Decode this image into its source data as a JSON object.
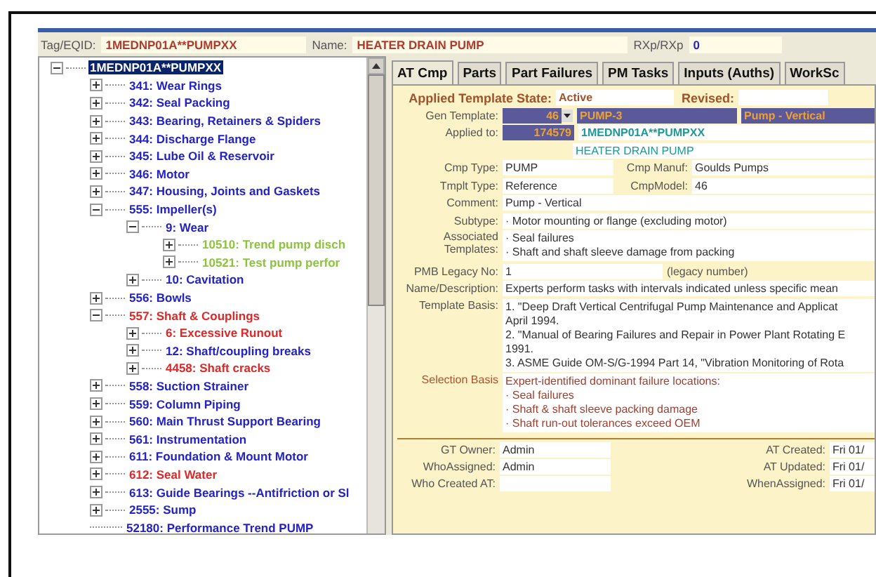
{
  "header": {
    "tag_label": "Tag/EQID:",
    "tag_value": "1MEDNP01A**PUMPXX",
    "name_label": "Name:",
    "name_value": "HEATER DRAIN PUMP",
    "rxp_label": "RXp/RXp",
    "rxp_value": "0"
  },
  "tree": {
    "root": {
      "label": "1MEDNP01A**PUMPXX",
      "selected": true,
      "expanded": true,
      "children": [
        {
          "label": "341: Wear Rings",
          "color": "#2323c8",
          "kind": "folder",
          "expanded": false
        },
        {
          "label": "342: Seal Packing",
          "color": "#2323c8",
          "kind": "folder",
          "expanded": false
        },
        {
          "label": "343: Bearing, Retainers & Spiders",
          "color": "#2323c8",
          "kind": "folder",
          "expanded": false
        },
        {
          "label": "344: Discharge Flange",
          "color": "#2323c8",
          "kind": "folder",
          "expanded": false
        },
        {
          "label": "345: Lube Oil & Reservoir",
          "color": "#2323c8",
          "kind": "folder",
          "expanded": false
        },
        {
          "label": "346: Motor",
          "color": "#2323c8",
          "kind": "folder",
          "expanded": false
        },
        {
          "label": "347: Housing, Joints and Gaskets",
          "color": "#2323c8",
          "kind": "folder",
          "expanded": false
        },
        {
          "label": "555: Impeller(s)",
          "color": "#2323c8",
          "kind": "folder",
          "expanded": true,
          "children": [
            {
              "label": "9: Wear",
              "color": "#2323c8",
              "kind": "folder",
              "expanded": true,
              "children": [
                {
                  "label": "10510: Trend pump disch",
                  "color": "#8cc43c",
                  "kind": "folder",
                  "expanded": false
                },
                {
                  "label": "10521: Test pump perfor",
                  "color": "#8cc43c",
                  "kind": "folder",
                  "expanded": false
                }
              ]
            },
            {
              "label": "10: Cavitation",
              "color": "#2323c8",
              "kind": "folder",
              "expanded": false
            }
          ]
        },
        {
          "label": "556: Bowls",
          "color": "#2323c8",
          "kind": "folder",
          "expanded": false
        },
        {
          "label": "557: Shaft & Couplings",
          "color": "#e02828",
          "kind": "folder",
          "expanded": true,
          "children": [
            {
              "label": "6: Excessive Runout",
              "color": "#e02828",
              "kind": "folder",
              "expanded": false
            },
            {
              "label": "12: Shaft/coupling breaks",
              "color": "#2323c8",
              "kind": "folder",
              "expanded": false
            },
            {
              "label": "4458: Shaft cracks",
              "color": "#e02828",
              "kind": "folder",
              "expanded": false
            }
          ]
        },
        {
          "label": "558: Suction Strainer",
          "color": "#2323c8",
          "kind": "folder",
          "expanded": false
        },
        {
          "label": "559: Column Piping",
          "color": "#2323c8",
          "kind": "folder",
          "expanded": false
        },
        {
          "label": "560: Main Thrust Support Bearing",
          "color": "#2323c8",
          "kind": "folder",
          "expanded": false
        },
        {
          "label": "561: Instrumentation",
          "color": "#2323c8",
          "kind": "folder",
          "expanded": false
        },
        {
          "label": "611: Foundation & Mount Motor",
          "color": "#2323c8",
          "kind": "folder",
          "expanded": false
        },
        {
          "label": "612: Seal Water",
          "color": "#e02828",
          "kind": "folder",
          "expanded": false
        },
        {
          "label": "613: Guide Bearings --Antifriction or Sl",
          "color": "#2323c8",
          "kind": "folder",
          "expanded": false
        },
        {
          "label": "2555: Sump",
          "color": "#2323c8",
          "kind": "folder",
          "expanded": false
        },
        {
          "label": "52180: Performance Trend PUMP",
          "color": "#2323c8",
          "kind": "leaf"
        }
      ]
    }
  },
  "tabs": [
    {
      "label": "AT Cmp",
      "selected": true
    },
    {
      "label": "Parts",
      "selected": false
    },
    {
      "label": "Part Failures",
      "selected": false
    },
    {
      "label": "PM Tasks",
      "selected": false
    },
    {
      "label": "Inputs (Auths)",
      "selected": false
    },
    {
      "label": "WorkSc",
      "selected": false
    }
  ],
  "form": {
    "state_label": "Applied Template State:",
    "state_value": "Active",
    "revised_label": "Revised:",
    "gen_template_label": "Gen Template:",
    "gen_template_number": "46",
    "gen_template_code": "PUMP-3",
    "gen_template_name": "Pump - Vertical",
    "applied_to_label": "Applied to:",
    "applied_to_number": "174579",
    "applied_to_tag": "1MEDNP01A**PUMPXX",
    "applied_to_name": "HEATER DRAIN PUMP",
    "cmp_type_label": "Cmp Type:",
    "cmp_type": "PUMP",
    "cmp_manuf_label": "Cmp Manuf:",
    "cmp_manuf": "Goulds Pumps",
    "tmplt_type_label": "Tmplt Type:",
    "tmplt_type": "Reference",
    "cmp_model_label": "CmpModel:",
    "cmp_model": "46",
    "comment_label": "Comment:",
    "comment": "Pump - Vertical",
    "subtype_label": "Subtype:",
    "subtype": "· Motor mounting or flange (excluding motor)",
    "associated_label": "Associated Templates:",
    "associated": [
      "· Seal failures",
      "· Shaft and shaft sleeve damage from packing"
    ],
    "pmb_label": "PMB Legacy No:",
    "pmb": "1",
    "pmb_note": "(legacy number)",
    "description_label": "Name/Description:",
    "description": "Experts perform tasks with intervals indicated unless specific mean",
    "basis_label": "Template Basis:",
    "basis": [
      "1. \"Deep Draft Vertical Centrifugal Pump Maintenance and Applicat",
      "April 1994.",
      "2. \"Manual of Bearing Failures and Repair in Power Plant Rotating E",
      "1991.",
      "3. ASME Guide OM-S/G-1994 Part 14, \"Vibration Monitoring of Rota"
    ],
    "selection_label": "Selection Basis",
    "selection": [
      "Expert-identified dominant failure locations:",
      "· Seal failures",
      "· Shaft & shaft sleeve packing damage",
      "· Shaft run-out tolerances exceed OEM"
    ]
  },
  "footer": {
    "left": [
      {
        "label": "GT Owner:",
        "value": "Admin"
      },
      {
        "label": "WhoAssigned:",
        "value": "Admin"
      },
      {
        "label": "Who Created AT:"
      }
    ],
    "right": [
      {
        "label": "AT Created:",
        "value": "Fri 01/"
      },
      {
        "label": "AT Updated:",
        "value": "Fri 01/"
      },
      {
        "label": "WhenAssigned:",
        "value": "Fri 01/"
      }
    ]
  }
}
